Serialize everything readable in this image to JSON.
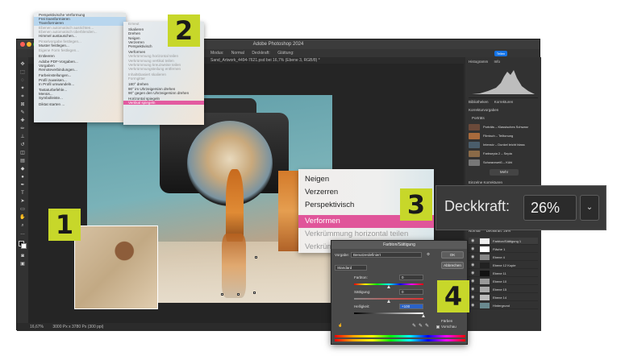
{
  "ps": {
    "title": "Adobe Photoshop 2024",
    "doc_tab": "Sand_Artwork_4494-7621.psd bei 16,7% (Ebene 3, RGB/8) *",
    "options": [
      "Modus:",
      "Normal",
      "Deckkraft:",
      "Glättung:"
    ],
    "share": "Teilen",
    "status": "16,67%",
    "status_doc": "3000 Px x 3780 Px (300 ppi)"
  },
  "panels": {
    "top_tabs": [
      "Histogramm",
      "Info"
    ],
    "adj_tabs": [
      "Bibliotheken",
      "Korrekturen"
    ],
    "adj_section": "Korrekturvorgaben",
    "presets_header": "Porträts",
    "presets": [
      {
        "label": "Porträts – Klassisches Schwarz",
        "color": "#6b4a3a"
      },
      {
        "label": "Filmisch – Teiltonung",
        "color": "#a86a3c"
      },
      {
        "label": "Intensiv – Dunkel leicht blass",
        "color": "#4a5d6b"
      },
      {
        "label": "Farbsepia 2 – Sepia",
        "color": "#8a6a48"
      },
      {
        "label": "Schwarzweiß – Kühl",
        "color": "#777777"
      }
    ],
    "more": "Mehr",
    "single_adj": "Einzelne Korrekturen",
    "layers_tabs": [
      "Ebenen",
      "Kanäle",
      "Pfade"
    ],
    "blend_mode": "Normal",
    "opacity_mini": "Deckkraft: 26%",
    "layers": [
      "Farbton/Sättigung 1",
      "Fläche 1",
      "Ebene 4",
      "Ebene 12 Kopie",
      "Ebene 11",
      "Ebene 10",
      "Ebene 15",
      "Ebene 14",
      "Hintergrund"
    ]
  },
  "menu_left": [
    {
      "t": "Perspektivische Verformung",
      "c": ""
    },
    {
      "t": "Frei transformieren",
      "c": "hl"
    },
    {
      "t": "Transformieren",
      "c": "hl"
    },
    {
      "t": "Ebenen automatisch ausrichten...",
      "c": "dim"
    },
    {
      "t": "Ebenen automatisch überblenden...",
      "c": "dim"
    },
    {
      "t": "Himmel austauschen...",
      "c": ""
    },
    {
      "sep": true
    },
    {
      "t": "Pinselvorgabe festlegen...",
      "c": "dim"
    },
    {
      "t": "Muster festlegen...",
      "c": ""
    },
    {
      "t": "Eigene Form festlegen...",
      "c": "dim"
    },
    {
      "sep": true
    },
    {
      "t": "Entleeren",
      "c": ""
    },
    {
      "sep": true
    },
    {
      "t": "Adobe PDF-Vorgaben...",
      "c": ""
    },
    {
      "t": "Vorgaben",
      "c": ""
    },
    {
      "t": "Remoteverbindungen...",
      "c": ""
    },
    {
      "sep": true
    },
    {
      "t": "Farbeinstellungen...",
      "c": ""
    },
    {
      "t": "Profil zuweisen...",
      "c": ""
    },
    {
      "t": "In Profil umwandeln...",
      "c": ""
    },
    {
      "sep": true
    },
    {
      "t": "Tastaturbefehle...",
      "c": ""
    },
    {
      "t": "Menüs...",
      "c": ""
    },
    {
      "t": "Symbolleiste...",
      "c": ""
    },
    {
      "sep": true
    },
    {
      "t": "Diktat starten ...",
      "c": ""
    }
  ],
  "menu_sub": [
    {
      "t": "Erneut",
      "c": "dim"
    },
    {
      "sep": true
    },
    {
      "t": "Skalieren",
      "c": ""
    },
    {
      "t": "Drehen",
      "c": ""
    },
    {
      "t": "Neigen",
      "c": ""
    },
    {
      "t": "Verzerren",
      "c": ""
    },
    {
      "t": "Perspektivisch",
      "c": ""
    },
    {
      "sep": true
    },
    {
      "t": "Verformen",
      "c": ""
    },
    {
      "t": "Verkrümmung horizontal teilen",
      "c": "dim"
    },
    {
      "t": "Verkrümmung vertikal teilen",
      "c": "dim"
    },
    {
      "t": "Verkrümmung kreuzweise teilen",
      "c": "dim"
    },
    {
      "t": "Verkrümmungsteilung entfernen",
      "c": "dim"
    },
    {
      "sep": true
    },
    {
      "t": "Inhaltsbasiert skalieren",
      "c": "dim"
    },
    {
      "t": "Formgitter",
      "c": "dim"
    },
    {
      "sep": true
    },
    {
      "t": "180° drehen",
      "c": ""
    },
    {
      "t": "90° im Uhrzeigersinn drehen",
      "c": ""
    },
    {
      "t": "90° gegen den Uhrzeigersinn drehen",
      "c": ""
    },
    {
      "sep": true
    },
    {
      "t": "Horizontal spiegeln",
      "c": ""
    },
    {
      "t": "Vertikal spiegeln",
      "c": "sel"
    }
  ],
  "menu_big": [
    {
      "t": "Neigen",
      "c": ""
    },
    {
      "t": "Verzerren",
      "c": ""
    },
    {
      "t": "Perspektivisch",
      "c": ""
    },
    {
      "sep": true
    },
    {
      "t": "Verformen",
      "c": "sel"
    },
    {
      "t": "Verkrümmung horizontal teilen",
      "c": "dim"
    },
    {
      "t": "Verkrümmung vertikal teilen",
      "c": "dim"
    }
  ],
  "opacity": {
    "label": "Deckkraft:",
    "value": "26%"
  },
  "hue": {
    "title": "Farbton/Sättigung",
    "preset_label": "Vorgabe:",
    "preset_value": "Benutzerdefiniert",
    "channel": "Standard",
    "hue_label": "Farbton:",
    "hue_value": "0",
    "sat_label": "Sättigung:",
    "sat_value": "0",
    "light_label": "Helligkeit:",
    "light_value": "+100",
    "ok": "OK",
    "cancel": "Abbrechen",
    "colorize": "Färben",
    "preview": "Vorschau"
  },
  "badges": [
    "1",
    "2",
    "3",
    "4"
  ],
  "colors": {
    "badge": "#c7d72a",
    "accent_pink": "#e0559a",
    "ps_blue": "#1473e6"
  }
}
